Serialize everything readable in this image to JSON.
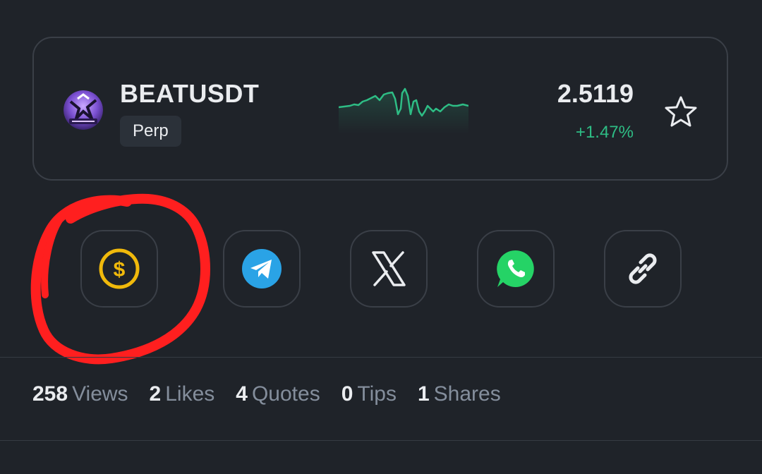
{
  "ticker": {
    "symbol": "BEATUSDT",
    "contract_type": "Perp",
    "price": "2.5119",
    "change": "+1.47%",
    "favorite_icon": "star-outline-icon",
    "coin_icon": "beat-coin-logo",
    "sparkline_trend": "up",
    "colors": {
      "positive": "#2ebd85"
    }
  },
  "share": {
    "buttons": [
      {
        "name": "tip",
        "icon": "dollar-circle-icon",
        "color": "#f0b90b",
        "highlighted": true
      },
      {
        "name": "telegram",
        "icon": "telegram-icon",
        "color": "#2aa3e6"
      },
      {
        "name": "x",
        "icon": "x-logo-icon",
        "color": "#eaecef"
      },
      {
        "name": "whatsapp",
        "icon": "whatsapp-icon",
        "color": "#25d366"
      },
      {
        "name": "copy-link",
        "icon": "link-icon",
        "color": "#eaecef"
      }
    ]
  },
  "stats": {
    "views": {
      "count": "258",
      "label": "Views"
    },
    "likes": {
      "count": "2",
      "label": "Likes"
    },
    "quotes": {
      "count": "4",
      "label": "Quotes"
    },
    "tips": {
      "count": "0",
      "label": "Tips"
    },
    "shares": {
      "count": "1",
      "label": "Shares"
    }
  },
  "annotation": {
    "shape": "hand-drawn circle",
    "color": "#ff1f1f"
  }
}
